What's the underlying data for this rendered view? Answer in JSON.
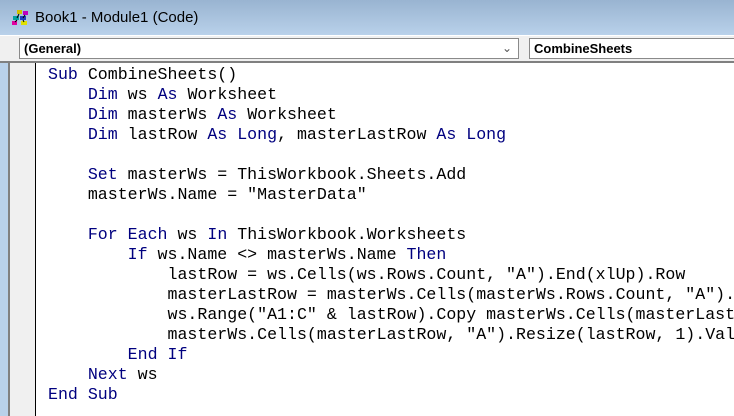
{
  "window": {
    "title": "Book1 - Module1 (Code)",
    "icon": "vba-module-icon"
  },
  "object_combo": {
    "value": "(General)"
  },
  "procedure_combo": {
    "value": "CombineSheets"
  },
  "colors": {
    "keyword": "#00007f",
    "title_bar": "#99b4d1"
  },
  "code_lines": [
    [
      [
        "k",
        "Sub"
      ],
      [
        "t",
        " CombineSheets()"
      ]
    ],
    [
      [
        "t",
        "    "
      ],
      [
        "k",
        "Dim"
      ],
      [
        "t",
        " ws "
      ],
      [
        "k",
        "As"
      ],
      [
        "t",
        " Worksheet"
      ]
    ],
    [
      [
        "t",
        "    "
      ],
      [
        "k",
        "Dim"
      ],
      [
        "t",
        " masterWs "
      ],
      [
        "k",
        "As"
      ],
      [
        "t",
        " Worksheet"
      ]
    ],
    [
      [
        "t",
        "    "
      ],
      [
        "k",
        "Dim"
      ],
      [
        "t",
        " lastRow "
      ],
      [
        "k",
        "As Long"
      ],
      [
        "t",
        ", masterLastRow "
      ],
      [
        "k",
        "As Long"
      ]
    ],
    [],
    [
      [
        "t",
        "    "
      ],
      [
        "k",
        "Set"
      ],
      [
        "t",
        " masterWs = ThisWorkbook.Sheets.Add"
      ]
    ],
    [
      [
        "t",
        "    masterWs.Name = \"MasterData\""
      ]
    ],
    [],
    [
      [
        "t",
        "    "
      ],
      [
        "k",
        "For Each"
      ],
      [
        "t",
        " ws "
      ],
      [
        "k",
        "In"
      ],
      [
        "t",
        " ThisWorkbook.Worksheets"
      ]
    ],
    [
      [
        "t",
        "        "
      ],
      [
        "k",
        "If"
      ],
      [
        "t",
        " ws.Name <> masterWs.Name "
      ],
      [
        "k",
        "Then"
      ]
    ],
    [
      [
        "t",
        "            lastRow = ws.Cells(ws.Rows.Count, \"A\").End(xlUp).Row"
      ]
    ],
    [
      [
        "t",
        "            masterLastRow = masterWs.Cells(masterWs.Rows.Count, \"A\")."
      ]
    ],
    [
      [
        "t",
        "            ws.Range(\"A1:C\" & lastRow).Copy masterWs.Cells(masterLast"
      ]
    ],
    [
      [
        "t",
        "            masterWs.Cells(masterLastRow, \"A\").Resize(lastRow, 1).Val"
      ]
    ],
    [
      [
        "t",
        "        "
      ],
      [
        "k",
        "End If"
      ]
    ],
    [
      [
        "t",
        "    "
      ],
      [
        "k",
        "Next"
      ],
      [
        "t",
        " ws"
      ]
    ],
    [
      [
        "k",
        "End Sub"
      ]
    ]
  ]
}
